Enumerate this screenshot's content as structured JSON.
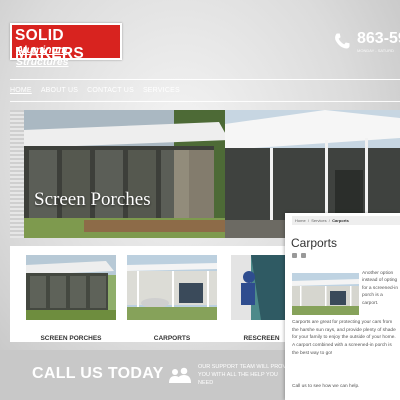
{
  "header": {
    "logo_line1": "SOLID MAKERS",
    "logo_line2": "Aluminum Structures",
    "phone": "863-59",
    "phone_sub": "MONDAY - SATURD"
  },
  "nav": {
    "items": [
      "HOME",
      "ABOUT US",
      "CONTACT US",
      "SERVICES"
    ]
  },
  "hero": {
    "caption": "Screen Porches"
  },
  "cards": [
    {
      "label": "SCREEN PORCHES"
    },
    {
      "label": "CARPORTS"
    },
    {
      "label": "RESCREEN"
    }
  ],
  "footer": {
    "call": "CALL US TODAY",
    "team_line1": "OUR SUPPORT TEAM WILL PROVID",
    "team_line2": "YOU WITH ALL THE HELP YOU NEED"
  },
  "popup": {
    "crumb_home": "Home",
    "crumb_services": "Services",
    "crumb_current": "Carports",
    "title": "Carports",
    "side_text": "Another option instead of opting for a screened-in porch is a carport.",
    "body": "Carports are great for protecting your cars from the harshe sun rays, and provide plenty of shade for your family to enjoy the outside of your home. A carport combined with a screened-in porch is the best way to go!",
    "cta": "Call us to see how we can help."
  },
  "colors": {
    "logo_red": "#d8231f",
    "card_bg": "#ffffff",
    "page_bg": "#dcdcdc"
  }
}
